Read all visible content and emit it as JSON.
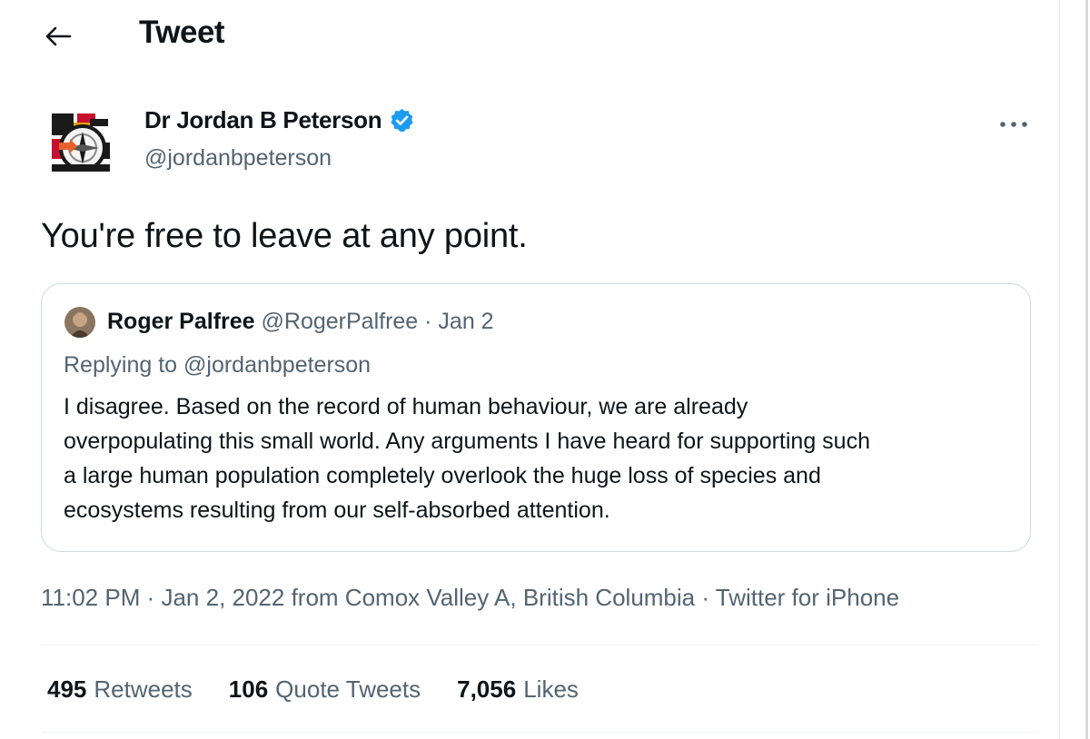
{
  "header": {
    "title": "Tweet",
    "back_icon": "arrow-left-icon"
  },
  "author": {
    "name": "Dr Jordan B Peterson",
    "handle": "@jordanbpeterson",
    "verified": true,
    "verified_color": "#1d9bf0",
    "more_icon": "more-dots-icon"
  },
  "tweet": {
    "text": "You're free to leave at any point."
  },
  "quote": {
    "name": "Roger Palfree",
    "meta": "@RogerPalfree · Jan 2",
    "replying_to": "Replying to @jordanbpeterson",
    "lines": [
      "I disagree. Based on the record of human behaviour, we are already",
      "overpopulating this small world. Any arguments I have heard for supporting such",
      "a large human population completely overlook the huge loss of species and",
      "ecosystems resulting from our self-absorbed attention."
    ]
  },
  "timestamp": "11:02 PM · Jan 2, 2022 from Comox Valley A, British Columbia · Twitter for iPhone",
  "stats": [
    {
      "count": "495",
      "label": "Retweets"
    },
    {
      "count": "106",
      "label": "Quote Tweets"
    },
    {
      "count": "7,056",
      "label": "Likes"
    }
  ],
  "colors": {
    "text": "#0f1419",
    "secondary": "#536471",
    "accent": "#1d9bf0",
    "border": "#cfd9de"
  }
}
